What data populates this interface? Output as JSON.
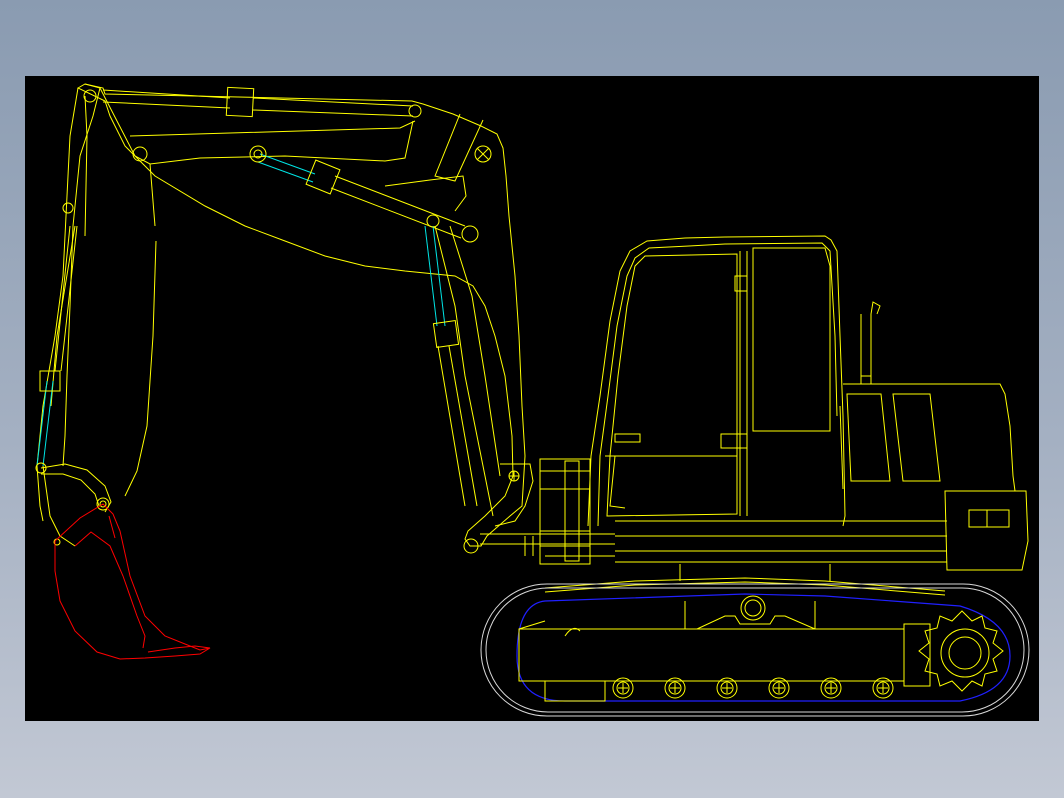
{
  "drawing": {
    "subject": "",
    "colors": {
      "background": "#000000",
      "outline": "#ffff00",
      "cylinders": "#00e6e6",
      "bucket": "#ff0000",
      "track_inner": "#2020ff",
      "track_outer": "#d8d8d8",
      "frame": "#8a9bb1"
    },
    "road_wheel_count": 6
  }
}
